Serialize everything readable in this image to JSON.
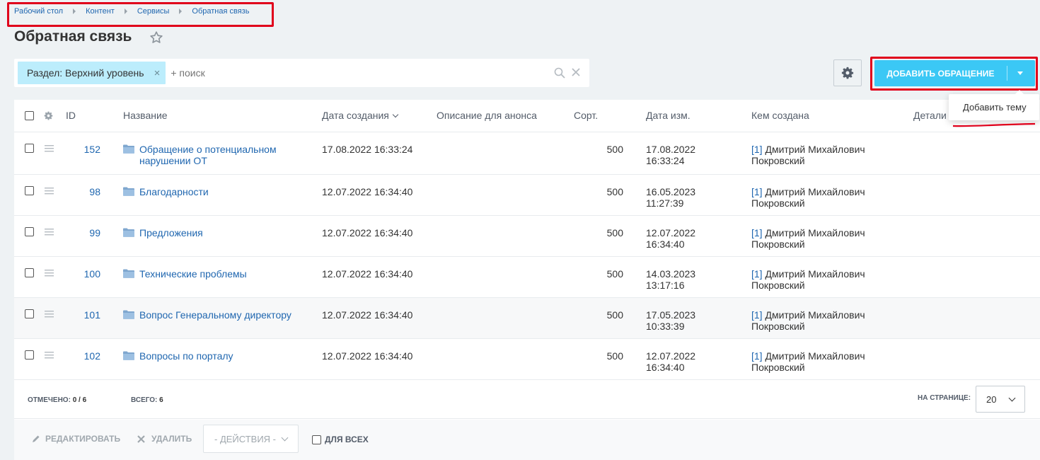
{
  "breadcrumb": [
    "Рабочий стол",
    "Контент",
    "Сервисы",
    "Обратная связь"
  ],
  "page_title": "Обратная связь",
  "filter": {
    "chip_label": "Раздел: Верхний уровень",
    "placeholder": "+ поиск"
  },
  "add_button": {
    "label": "ДОБАВИТЬ ОБРАЩЕНИЕ"
  },
  "add_menu": {
    "item": "Добавить тему"
  },
  "columns": {
    "id": "ID",
    "name": "Название",
    "created": "Дата создания",
    "announce": "Описание для анонса",
    "sort": "Сорт.",
    "modified": "Дата изм.",
    "author": "Кем создана",
    "details": "Детали"
  },
  "rows": [
    {
      "id": "152",
      "name": "Обращение о потенциальном нарушении ОТ",
      "created": "17.08.2022 16:33:24",
      "sort": "500",
      "modified_date": "17.08.2022",
      "modified_time": "16:33:24",
      "author_id": "[1]",
      "author_name": "Дмитрий Михайлович Покровский"
    },
    {
      "id": "98",
      "name": "Благодарности",
      "created": "12.07.2022 16:34:40",
      "sort": "500",
      "modified_date": "16.05.2023",
      "modified_time": "11:27:39",
      "author_id": "[1]",
      "author_name": "Дмитрий Михайлович Покровский"
    },
    {
      "id": "99",
      "name": "Предложения",
      "created": "12.07.2022 16:34:40",
      "sort": "500",
      "modified_date": "12.07.2022",
      "modified_time": "16:34:40",
      "author_id": "[1]",
      "author_name": "Дмитрий Михайлович Покровский"
    },
    {
      "id": "100",
      "name": "Технические проблемы",
      "created": "12.07.2022 16:34:40",
      "sort": "500",
      "modified_date": "14.03.2023",
      "modified_time": "13:17:16",
      "author_id": "[1]",
      "author_name": "Дмитрий Михайлович Покровский"
    },
    {
      "id": "101",
      "name": "Вопрос Генеральному директору",
      "created": "12.07.2022 16:34:40",
      "sort": "500",
      "modified_date": "17.05.2023",
      "modified_time": "10:33:39",
      "author_id": "[1]",
      "author_name": "Дмитрий Михайлович Покровский"
    },
    {
      "id": "102",
      "name": "Вопросы по порталу",
      "created": "12.07.2022 16:34:40",
      "sort": "500",
      "modified_date": "12.07.2022",
      "modified_time": "16:34:40",
      "author_id": "[1]",
      "author_name": "Дмитрий Михайлович Покровский"
    }
  ],
  "footer": {
    "selected_label": "ОТМЕЧЕНО:",
    "selected_value": "0 / 6",
    "total_label": "ВСЕГО:",
    "total_value": "6",
    "per_page_label": "НА СТРАНИЦЕ:",
    "per_page_value": "20"
  },
  "actions": {
    "edit": "РЕДАКТИРОВАТЬ",
    "delete": "УДАЛИТЬ",
    "select": "- ДЕЙСТВИЯ -",
    "for_all": "ДЛЯ ВСЕХ"
  },
  "colors": {
    "accent": "#3bc8f5",
    "link": "#2067b0",
    "chip": "#bcedfc",
    "highlight_annotation": "#e0001b"
  },
  "icons": [
    "star-icon",
    "search-icon",
    "clear-icon",
    "gear-icon",
    "dropdown-caret-icon",
    "drag-handle-icon",
    "folder-icon",
    "pencil-icon",
    "cross-icon",
    "chevron-down-icon"
  ]
}
